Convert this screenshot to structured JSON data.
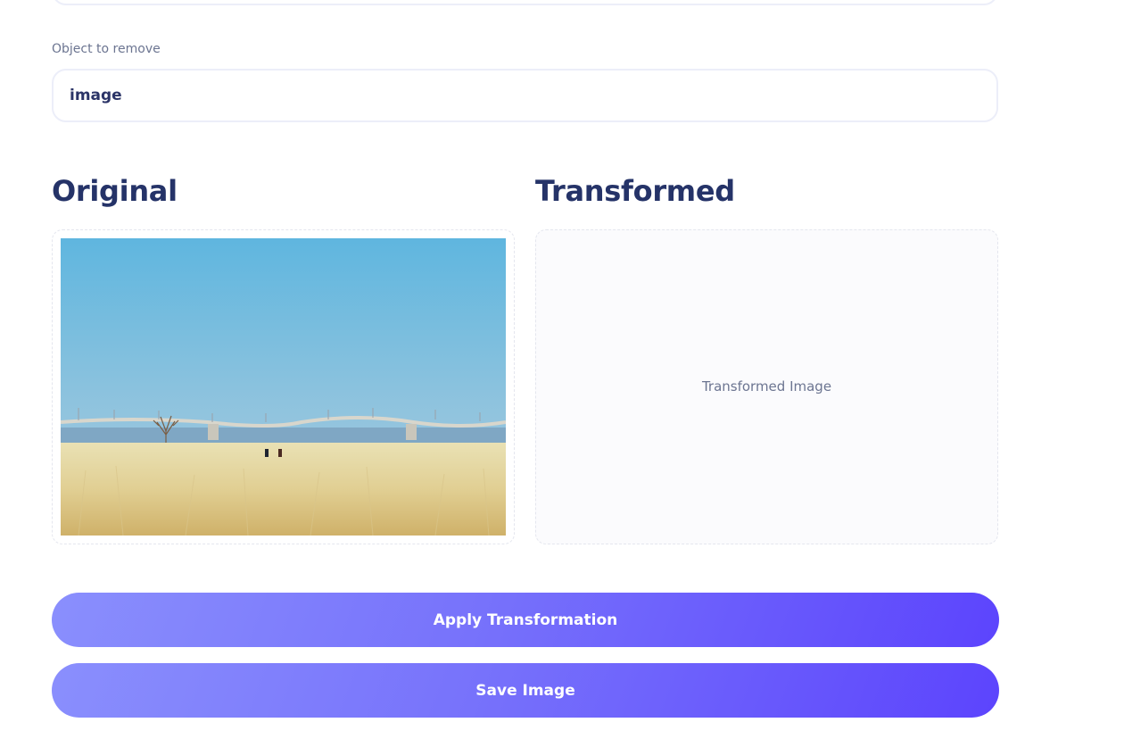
{
  "form": {
    "object_label": "Object to remove",
    "object_value": "image"
  },
  "original": {
    "title": "Original"
  },
  "transformed": {
    "title": "Transformed",
    "placeholder": "Transformed Image"
  },
  "actions": {
    "apply_label": "Apply Transformation",
    "save_label": "Save Image"
  }
}
